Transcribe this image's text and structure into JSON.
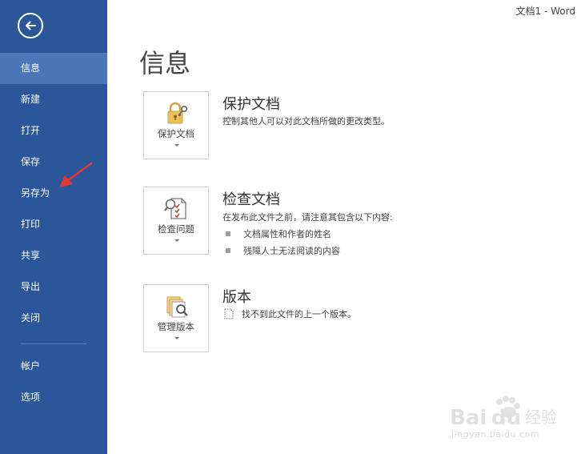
{
  "window": {
    "title": "文档1 - Word"
  },
  "sidebar": {
    "items": [
      {
        "label": "信息",
        "active": true
      },
      {
        "label": "新建"
      },
      {
        "label": "打开"
      },
      {
        "label": "保存"
      },
      {
        "label": "另存为"
      },
      {
        "label": "打印"
      },
      {
        "label": "共享"
      },
      {
        "label": "导出"
      },
      {
        "label": "关闭"
      }
    ],
    "bottom_items": [
      {
        "label": "帐户"
      },
      {
        "label": "选项"
      }
    ]
  },
  "main": {
    "title": "信息",
    "protect": {
      "button_label": "保护文档",
      "title": "保护文档",
      "description": "控制其他人可以对此文档所做的更改类型。"
    },
    "inspect": {
      "button_label": "检查问题",
      "title": "检查文档",
      "description": "在发布此文件之前，请注意其包含以下内容:",
      "bullets": [
        "文档属性和作者的姓名",
        "残障人士无法阅读的内容"
      ]
    },
    "versions": {
      "button_label": "管理版本",
      "title": "版本",
      "description": "找不到此文件的上一个版本。"
    }
  },
  "watermark": {
    "text": "jingyan.baidu.com",
    "brand": "Baidu 经验"
  },
  "colors": {
    "sidebar_bg": "#2b579a",
    "sidebar_active": "#4a77b8",
    "annotation_arrow": "#e53935"
  }
}
